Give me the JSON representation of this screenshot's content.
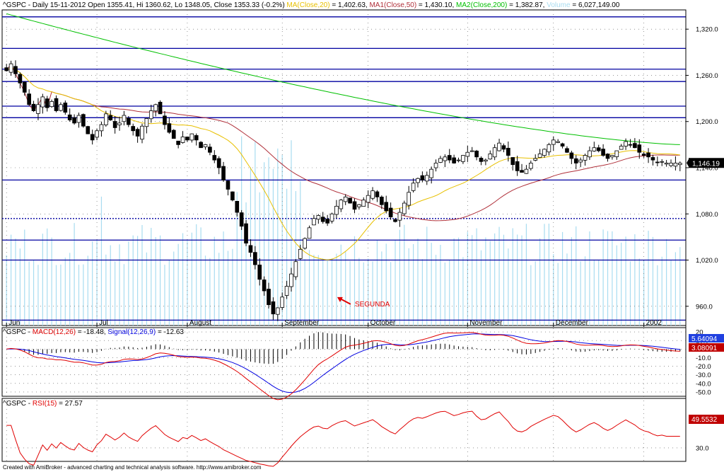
{
  "header": {
    "price": {
      "prefix": "^GSPC - Daily 15-11-2012 Open 1355.41, Hi 1360.62, Lo 1348.05, Close 1353.33 (-0.2%) ",
      "ma20": "MA(Close,20)",
      "ma20_val": " = 1,402.63, ",
      "ma50": "MA1(Close,50)",
      "ma50_val": " = 1,430.10, ",
      "ma200": "MA2(Close,200)",
      "ma200_val": " = 1,382.87, ",
      "vol": "Volume",
      "vol_val": " = 6,027,149.00"
    },
    "macd": {
      "prefix": "^GSPC - ",
      "macd": "MACD(12,26)",
      "macd_val": " = -18.48, ",
      "signal": "Signal(12,26,9)",
      "signal_val": " = -12.63"
    },
    "rsi": {
      "prefix": "^GSPC - ",
      "rsi": "RSI(15)",
      "rsi_val": " = 27.57"
    }
  },
  "footer": "Created with AmiBroker - advanced charting and technical analysis software. http://www.amibroker.com",
  "colors": {
    "ma20": "#e8c000",
    "ma50": "#b0303a",
    "ma200": "#00c000",
    "volume": "#a8dcf0",
    "hlines": "#0000a0",
    "macd": "#e00000",
    "signal": "#0000e0",
    "rsi": "#e00000",
    "last_price_bg": "#000000",
    "macd_tag_blue": "#2040e0",
    "macd_tag_red": "#c00000",
    "rsi_tag": "#c00000"
  },
  "chart_data": [
    {
      "type": "candlestick",
      "name": "price",
      "ylim": [
        935,
        1345
      ],
      "yticks": [
        960,
        1020,
        1080,
        1140,
        1200,
        1260,
        1320
      ],
      "ytick_labels": [
        "960.0",
        "1,020.0",
        "1,080.0",
        "1,140.0",
        "1,200.0",
        "1,260.0",
        "1,320.0"
      ],
      "x_months": [
        {
          "label": "Jun",
          "i": 0
        },
        {
          "label": "Jul",
          "i": 20
        },
        {
          "label": "August",
          "i": 40
        },
        {
          "label": "September",
          "i": 61
        },
        {
          "label": "October",
          "i": 80
        },
        {
          "label": "November",
          "i": 102
        },
        {
          "label": "December",
          "i": 121
        },
        {
          "label": "2002",
          "i": 141
        }
      ],
      "n_bars": 150,
      "hlines": [
        1336,
        1295,
        1268,
        1252,
        1220,
        1205,
        1124,
        1046,
        1020,
        942
      ],
      "hline_dashed": [
        1074
      ],
      "last_price": 1146.19,
      "last_price_label": "1,146.19",
      "annotation": {
        "text": "SEGUNDA",
        "i": 73,
        "price": 970
      },
      "close_path": [
        1266,
        1275,
        1262,
        1250,
        1238,
        1222,
        1214,
        1222,
        1232,
        1218,
        1226,
        1214,
        1222,
        1212,
        1202,
        1198,
        1208,
        1194,
        1184,
        1176,
        1188,
        1196,
        1210,
        1202,
        1192,
        1198,
        1208,
        1196,
        1188,
        1181,
        1194,
        1204,
        1214,
        1222,
        1210,
        1196,
        1186,
        1178,
        1170,
        1180,
        1176,
        1184,
        1176,
        1166,
        1170,
        1160,
        1150,
        1140,
        1124,
        1112,
        1098,
        1082,
        1064,
        1042,
        1030,
        1014,
        995,
        980,
        962,
        950,
        958,
        972,
        986,
        1002,
        1018,
        1034,
        1048,
        1062,
        1074,
        1078,
        1070,
        1068,
        1080,
        1090,
        1098,
        1102,
        1094,
        1086,
        1092,
        1098,
        1104,
        1110,
        1102,
        1092,
        1084,
        1076,
        1070,
        1082,
        1094,
        1108,
        1120,
        1126,
        1124,
        1130,
        1138,
        1146,
        1152,
        1154,
        1150,
        1146,
        1150,
        1156,
        1160,
        1162,
        1154,
        1148,
        1150,
        1158,
        1166,
        1172,
        1164,
        1156,
        1144,
        1136,
        1134,
        1138,
        1146,
        1152,
        1158,
        1164,
        1170,
        1176,
        1174,
        1168,
        1160,
        1152,
        1146,
        1150,
        1156,
        1162,
        1166,
        1162,
        1156,
        1152,
        1156,
        1162,
        1168,
        1174,
        1170,
        1166,
        1160,
        1156,
        1154,
        1150,
        1147,
        1148,
        1146,
        1146,
        1146
      ]
    },
    {
      "type": "line",
      "name": "macd",
      "ylim": [
        -55,
        25
      ],
      "yticks": [
        20,
        10,
        0,
        -10,
        -20,
        -30,
        -40,
        -50
      ],
      "ytick_labels": [
        "20",
        "10.0",
        "0",
        "-10.0",
        "-20.0",
        "-30.0",
        "-40.0",
        "-50.0"
      ],
      "macd_tag": "5.64094",
      "signal_tag": "3.08091"
    },
    {
      "type": "line",
      "name": "rsi",
      "ylim": [
        15,
        85
      ],
      "yticks": [
        30
      ],
      "ytick_labels": [
        "30.0"
      ],
      "rsi_tag": "49.5532"
    }
  ]
}
